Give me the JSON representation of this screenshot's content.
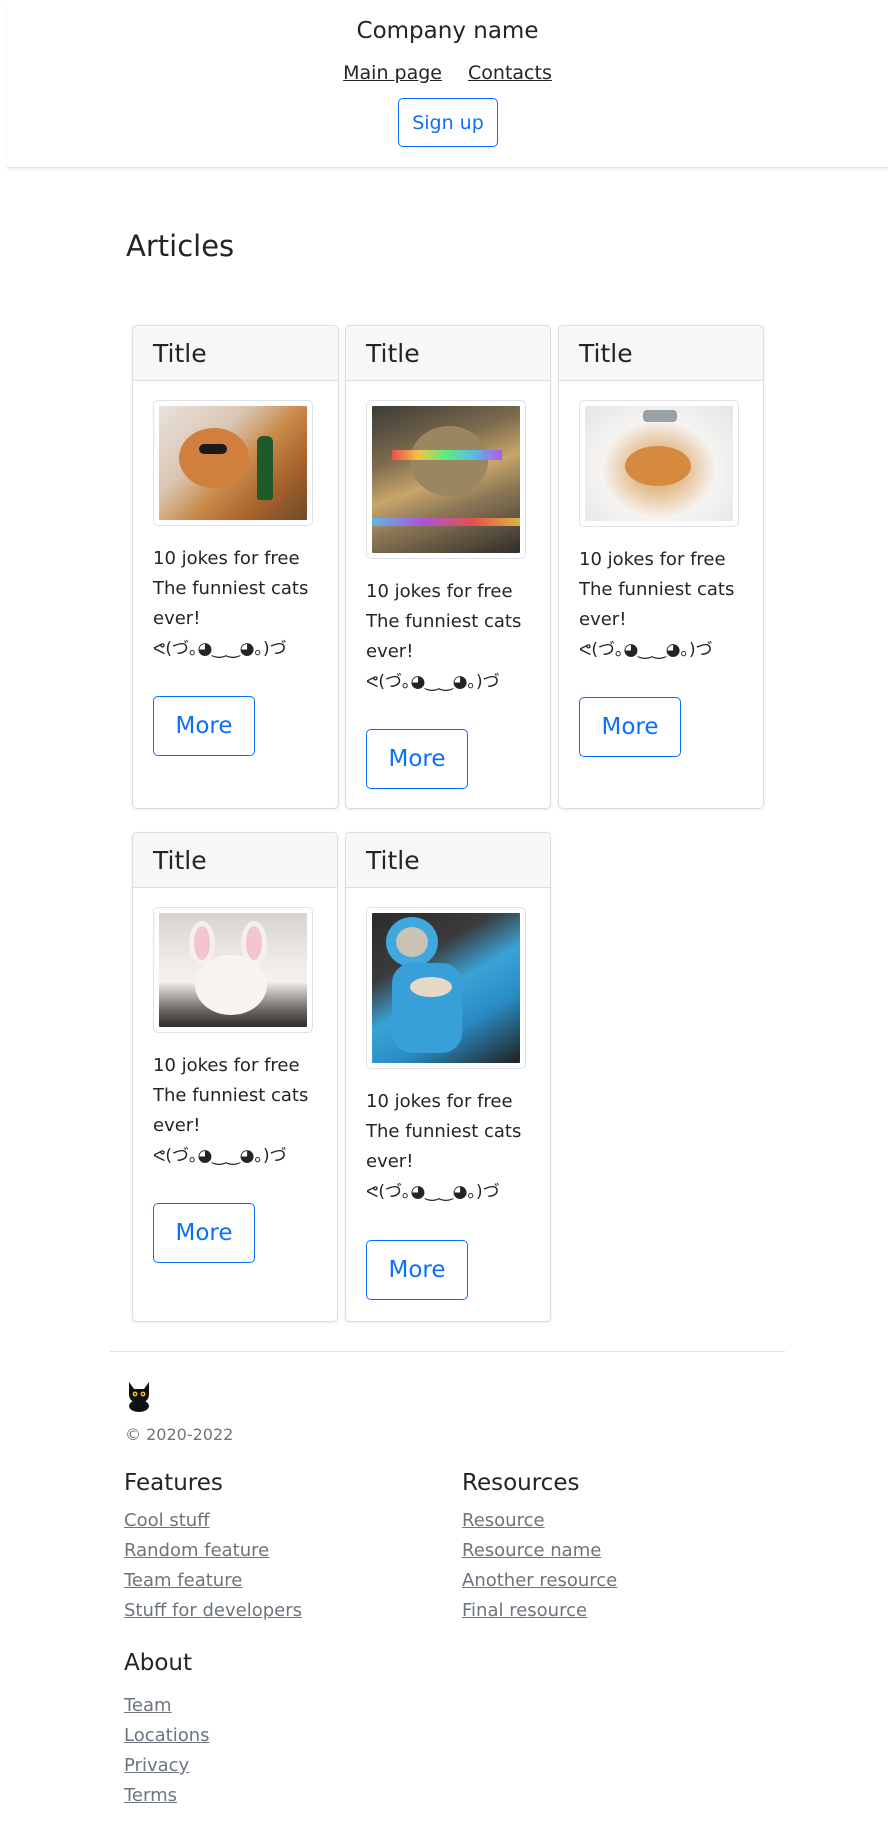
{
  "header": {
    "company": "Company name",
    "nav": [
      "Main page",
      "Contacts"
    ],
    "signup": "Sign up"
  },
  "articles": {
    "title": "Articles",
    "cards": [
      {
        "title": "Title",
        "line1": "10 jokes for free",
        "line2": "The funniest cats ever!",
        "emoticon": "ᕙ(づ｡◕‿‿◕｡)づ",
        "button": "More"
      },
      {
        "title": "Title",
        "line1": "10 jokes for free",
        "line2": "The funniest cats ever!",
        "emoticon": "ᕙ(づ｡◕‿‿◕｡)づ",
        "button": "More"
      },
      {
        "title": "Title",
        "line1": "10 jokes for free",
        "line2": "The funniest cats ever!",
        "emoticon": "ᕙ(づ｡◕‿‿◕｡)づ",
        "button": "More"
      },
      {
        "title": "Title",
        "line1": "10 jokes for free",
        "line2": "The funniest cats ever!",
        "emoticon": "ᕙ(づ｡◕‿‿◕｡)づ",
        "button": "More"
      },
      {
        "title": "Title",
        "line1": "10 jokes for free",
        "line2": "The funniest cats ever!",
        "emoticon": "ᕙ(づ｡◕‿‿◕｡)づ",
        "button": "More"
      }
    ]
  },
  "footer": {
    "logo_icon": "black-cat-icon",
    "copyright": "© 2020-2022",
    "features": {
      "title": "Features",
      "links": [
        "Cool stuff",
        "Random feature",
        "Team feature",
        "Stuff for developers"
      ]
    },
    "resources": {
      "title": "Resources",
      "links": [
        "Resource",
        "Resource name",
        "Another resource",
        "Final resource"
      ]
    },
    "about": {
      "title": "About",
      "links": [
        "Team",
        "Locations",
        "Privacy",
        "Terms"
      ]
    }
  },
  "colors": {
    "accent": "#0d6efd",
    "muted": "#6c757d",
    "text": "#212529"
  }
}
